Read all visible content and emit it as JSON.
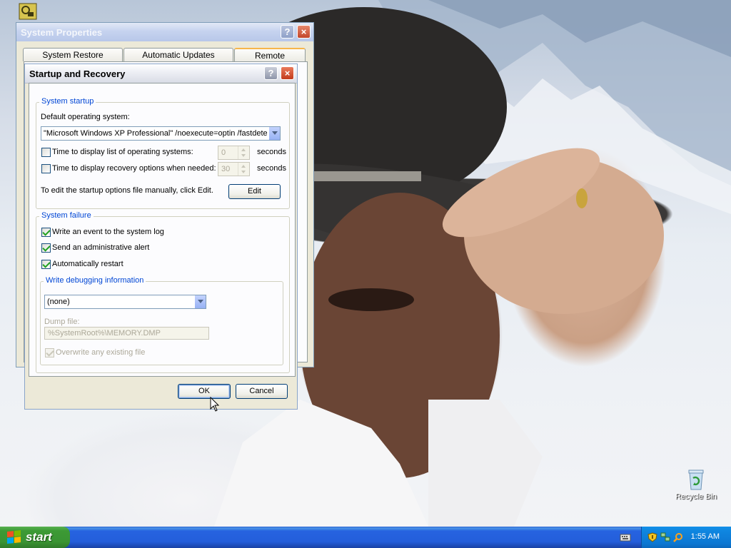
{
  "desktop": {
    "recycle_bin_label": "Recycle Bin"
  },
  "system_properties": {
    "title": "System Properties",
    "tabs": [
      "System Restore",
      "Automatic Updates",
      "Remote"
    ],
    "selected_tab": "Remote"
  },
  "startup_recovery": {
    "title": "Startup and Recovery",
    "help_glyph": "?",
    "close_glyph": "×",
    "system_startup": {
      "legend": "System startup",
      "default_os_label": "Default operating system:",
      "default_os_value": "\"Microsoft Windows XP Professional\" /noexecute=optin /fastdete",
      "time_list_label": "Time to display list of operating systems:",
      "time_list_checked": false,
      "time_list_value": "0",
      "time_recovery_label": "Time to display recovery options when needed:",
      "time_recovery_checked": false,
      "time_recovery_value": "30",
      "seconds_label": "seconds",
      "edit_hint": "To edit the startup options file manually, click Edit.",
      "edit_button": "Edit"
    },
    "system_failure": {
      "legend": "System failure",
      "write_event_label": "Write an event to the system log",
      "write_event_checked": true,
      "send_alert_label": "Send an administrative alert",
      "send_alert_checked": true,
      "auto_restart_label": "Automatically restart",
      "auto_restart_checked": true,
      "debug_legend": "Write debugging information",
      "debug_value": "(none)",
      "dump_file_label": "Dump file:",
      "dump_file_value": "%SystemRoot%\\MEMORY.DMP",
      "overwrite_label": "Overwrite any existing file",
      "overwrite_checked": true
    },
    "ok_button": "OK",
    "cancel_button": "Cancel"
  },
  "taskbar": {
    "start_label": "start",
    "clock": "1:55 AM"
  },
  "colors": {
    "taskbar_blue": "#245edb",
    "start_green": "#3c9a35",
    "tray_blue": "#0f86e0",
    "group_legend_blue": "#0046d5"
  },
  "icons": [
    "recycle-bin-icon",
    "windows-flag-icon",
    "keyboard-icon",
    "security-shield-icon",
    "network-icon",
    "search-icon",
    "mouse-cursor-icon"
  ]
}
